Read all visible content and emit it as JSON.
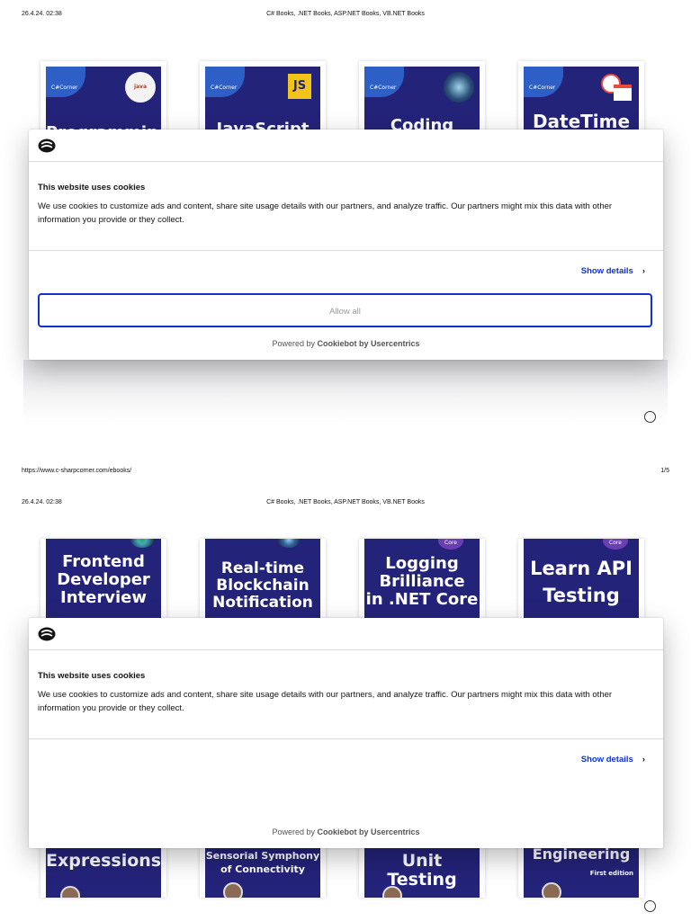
{
  "header": {
    "date": "26.4.24. 02:38",
    "title": "C# Books, .NET Books, ASP.NET Books, VB.NET Books"
  },
  "footer": {
    "url": "https://www.c-sharpcorner.com/ebooks/",
    "page": "1/5"
  },
  "brand": {
    "corner_label": "C#Corner",
    "cover_color": "#24237a",
    "accent_color": "#1032cf"
  },
  "page1_books": [
    {
      "title": "Programming",
      "badge": "java"
    },
    {
      "title": "JavaScript",
      "badge": "JS"
    },
    {
      "title": "Coding",
      "badge": ""
    },
    {
      "title": "DateTime",
      "badge": ""
    }
  ],
  "page2_books_top": [
    {
      "title_lines": [
        "Frontend",
        "Developer",
        "Interview"
      ]
    },
    {
      "title_lines": [
        "Real-time",
        "Blockchain",
        "Notification"
      ]
    },
    {
      "title_lines": [
        "Logging",
        "Brilliance",
        "in .NET Core"
      ],
      "badge": "Core"
    },
    {
      "title_lines": [
        "Learn API",
        "Testing"
      ],
      "badge": "Core"
    }
  ],
  "page2_books_bottom": [
    {
      "title_lines": [
        "Expressions"
      ]
    },
    {
      "title_lines": [
        "Sensorial Symphony",
        "of Connectivity"
      ]
    },
    {
      "title_lines": [
        "Unit Testing"
      ]
    },
    {
      "title_lines": [
        "Engineering"
      ],
      "subtitle": "First edition"
    }
  ],
  "cookie": {
    "heading": "This website uses cookies",
    "body": "We use cookies to customize ads and content, share site usage details with our partners, and analyze traffic. Our partners might mix this data with other information you provide or they collect.",
    "show_details": "Show details",
    "allow_all": "Allow all",
    "powered_prefix": "Powered by",
    "powered_brand": "Cookiebot by Usercentrics"
  }
}
